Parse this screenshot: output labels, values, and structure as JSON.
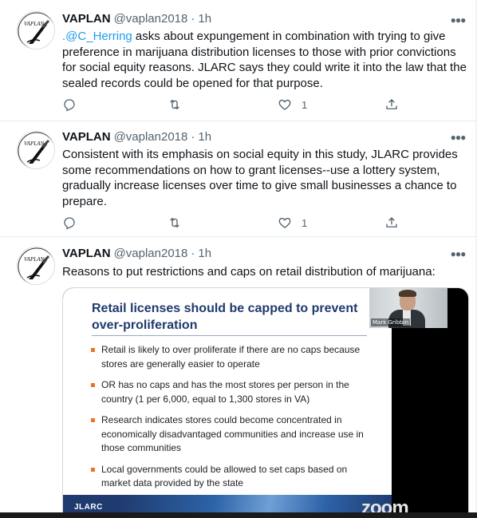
{
  "colors": {
    "link": "#1d9bf0",
    "secondary_text": "#536471",
    "slide_title": "#1f3a6e",
    "bullet": "#e8742a"
  },
  "icons": {
    "avatar": "vaplan-quill-logo",
    "more": "more-icon",
    "reply": "reply-icon",
    "retweet": "retweet-icon",
    "like": "heart-icon",
    "share": "share-icon"
  },
  "avatar_text": "VAPLAN",
  "tweets": [
    {
      "name": "VAPLAN",
      "handle": "@vaplan2018",
      "dot": "·",
      "time": "1h",
      "mention": ".@C_Herring",
      "text": " asks about expungement in combination with trying to give preference in marijuana distribution licenses to those with prior convictions for social equity reasons. JLARC says they could write it into the law that the sealed records could be opened for that purpose.",
      "like_count": "1"
    },
    {
      "name": "VAPLAN",
      "handle": "@vaplan2018",
      "dot": "·",
      "time": "1h",
      "text": "Consistent with its emphasis on social equity in this study, JLARC provides some recommendations on how to grant licenses--use a lottery system, gradually increase licenses over time to give small businesses a chance to prepare.",
      "like_count": "1"
    },
    {
      "name": "VAPLAN",
      "handle": "@vaplan2018",
      "dot": "·",
      "time": "1h",
      "text": "Reasons to put restrictions and caps on retail distribution of marijuana:",
      "media": {
        "slide_title": "Retail licenses should be capped to prevent over-proliferation",
        "bullets": [
          "Retail is likely to over proliferate if there are no caps because stores are generally easier to operate",
          "OR has no caps and has the most stores per person in the country (1 per 6,000, equal to 1,300 stores in VA)",
          "Research indicates stores could become concentrated in economically disadvantaged communities and increase use in those communities",
          "Local governments could be allowed to set caps based on market data provided by the state"
        ],
        "footer_label": "JLARC",
        "zoom_label": "zoom",
        "webcam_name": "Mark Gribbin"
      }
    }
  ]
}
